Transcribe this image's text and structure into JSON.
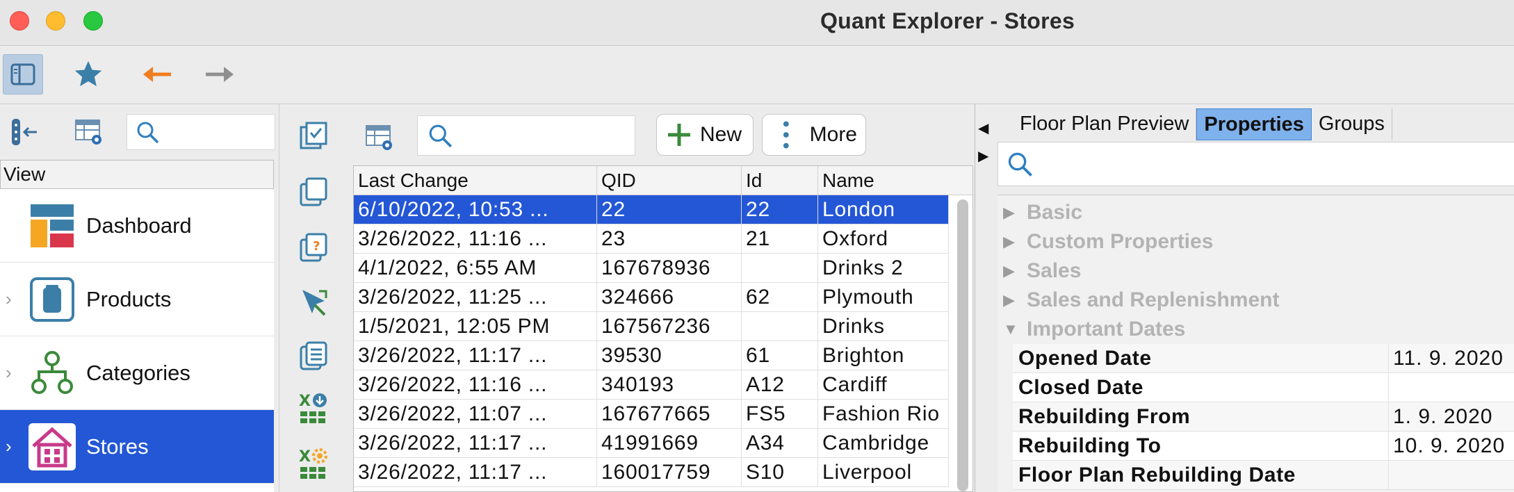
{
  "window": {
    "title": "Quant Explorer - Stores"
  },
  "toolbar": {
    "buttons": [
      "sidebar-toggle-icon",
      "favorite-star-icon",
      "back-arrow-icon",
      "forward-arrow-icon"
    ]
  },
  "left": {
    "view_header": "View",
    "nav": [
      {
        "label": "Dashboard",
        "icon": "dashboard-icon",
        "expandable": false,
        "selected": false
      },
      {
        "label": "Products",
        "icon": "products-icon",
        "expandable": true,
        "selected": false
      },
      {
        "label": "Categories",
        "icon": "categories-icon",
        "expandable": true,
        "selected": false
      },
      {
        "label": "Stores",
        "icon": "stores-icon",
        "expandable": true,
        "selected": true
      }
    ]
  },
  "middle": {
    "new_label": "New",
    "more_label": "More",
    "columns": [
      "Last Change",
      "QID",
      "Id",
      "Name"
    ],
    "rows": [
      {
        "last_change": "6/10/2022, 10:53 ...",
        "qid": "22",
        "id": "22",
        "name": "London",
        "selected": true
      },
      {
        "last_change": "3/26/2022, 11:16 ...",
        "qid": "23",
        "id": "21",
        "name": "Oxford"
      },
      {
        "last_change": "4/1/2022, 6:55 AM",
        "qid": "167678936",
        "id": "",
        "name": "Drinks 2"
      },
      {
        "last_change": "3/26/2022, 11:25 ...",
        "qid": "324666",
        "id": "62",
        "name": "Plymouth"
      },
      {
        "last_change": "1/5/2021, 12:05 PM",
        "qid": "167567236",
        "id": "",
        "name": "Drinks"
      },
      {
        "last_change": "3/26/2022, 11:17 ...",
        "qid": "39530",
        "id": "61",
        "name": "Brighton"
      },
      {
        "last_change": "3/26/2022, 11:16 ...",
        "qid": "340193",
        "id": "A12",
        "name": "Cardiff"
      },
      {
        "last_change": "3/26/2022, 11:07 ...",
        "qid": "167677665",
        "id": "FS5",
        "name": "Fashion Rio"
      },
      {
        "last_change": "3/26/2022, 11:17 ...",
        "qid": "41991669",
        "id": "A34",
        "name": "Cambridge"
      },
      {
        "last_change": "3/26/2022, 11:17 ...",
        "qid": "160017759",
        "id": "S10",
        "name": "Liverpool"
      }
    ]
  },
  "right": {
    "tabs": [
      "Floor Plan Preview",
      "Properties",
      "Groups"
    ],
    "active_tab": "Properties",
    "groups": [
      "Basic",
      "Custom Properties",
      "Sales",
      "Sales and Replenishment",
      "Important Dates"
    ],
    "expanded_group": "Important Dates",
    "properties": [
      {
        "key": "Opened Date",
        "value": "11. 9. 2020"
      },
      {
        "key": "Closed Date",
        "value": ""
      },
      {
        "key": "Rebuilding From",
        "value": "1. 9. 2020"
      },
      {
        "key": "Rebuilding To",
        "value": "10. 9. 2020"
      },
      {
        "key": "Floor Plan Rebuilding Date",
        "value": ""
      }
    ]
  },
  "colors": {
    "selection": "#2457d6",
    "active_tab": "#7fb2ec",
    "accent_orange": "#f07d1f",
    "icon_blue": "#3b7fa8"
  }
}
